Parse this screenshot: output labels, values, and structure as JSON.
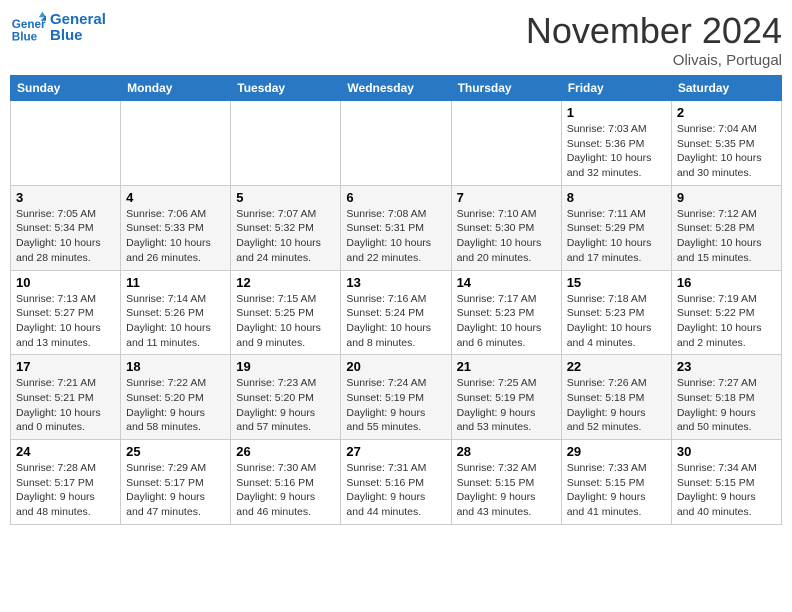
{
  "header": {
    "logo_line1": "General",
    "logo_line2": "Blue",
    "month": "November 2024",
    "location": "Olivais, Portugal"
  },
  "days_of_week": [
    "Sunday",
    "Monday",
    "Tuesday",
    "Wednesday",
    "Thursday",
    "Friday",
    "Saturday"
  ],
  "weeks": [
    [
      {
        "day": "",
        "info": ""
      },
      {
        "day": "",
        "info": ""
      },
      {
        "day": "",
        "info": ""
      },
      {
        "day": "",
        "info": ""
      },
      {
        "day": "",
        "info": ""
      },
      {
        "day": "1",
        "info": "Sunrise: 7:03 AM\nSunset: 5:36 PM\nDaylight: 10 hours and 32 minutes."
      },
      {
        "day": "2",
        "info": "Sunrise: 7:04 AM\nSunset: 5:35 PM\nDaylight: 10 hours and 30 minutes."
      }
    ],
    [
      {
        "day": "3",
        "info": "Sunrise: 7:05 AM\nSunset: 5:34 PM\nDaylight: 10 hours and 28 minutes."
      },
      {
        "day": "4",
        "info": "Sunrise: 7:06 AM\nSunset: 5:33 PM\nDaylight: 10 hours and 26 minutes."
      },
      {
        "day": "5",
        "info": "Sunrise: 7:07 AM\nSunset: 5:32 PM\nDaylight: 10 hours and 24 minutes."
      },
      {
        "day": "6",
        "info": "Sunrise: 7:08 AM\nSunset: 5:31 PM\nDaylight: 10 hours and 22 minutes."
      },
      {
        "day": "7",
        "info": "Sunrise: 7:10 AM\nSunset: 5:30 PM\nDaylight: 10 hours and 20 minutes."
      },
      {
        "day": "8",
        "info": "Sunrise: 7:11 AM\nSunset: 5:29 PM\nDaylight: 10 hours and 17 minutes."
      },
      {
        "day": "9",
        "info": "Sunrise: 7:12 AM\nSunset: 5:28 PM\nDaylight: 10 hours and 15 minutes."
      }
    ],
    [
      {
        "day": "10",
        "info": "Sunrise: 7:13 AM\nSunset: 5:27 PM\nDaylight: 10 hours and 13 minutes."
      },
      {
        "day": "11",
        "info": "Sunrise: 7:14 AM\nSunset: 5:26 PM\nDaylight: 10 hours and 11 minutes."
      },
      {
        "day": "12",
        "info": "Sunrise: 7:15 AM\nSunset: 5:25 PM\nDaylight: 10 hours and 9 minutes."
      },
      {
        "day": "13",
        "info": "Sunrise: 7:16 AM\nSunset: 5:24 PM\nDaylight: 10 hours and 8 minutes."
      },
      {
        "day": "14",
        "info": "Sunrise: 7:17 AM\nSunset: 5:23 PM\nDaylight: 10 hours and 6 minutes."
      },
      {
        "day": "15",
        "info": "Sunrise: 7:18 AM\nSunset: 5:23 PM\nDaylight: 10 hours and 4 minutes."
      },
      {
        "day": "16",
        "info": "Sunrise: 7:19 AM\nSunset: 5:22 PM\nDaylight: 10 hours and 2 minutes."
      }
    ],
    [
      {
        "day": "17",
        "info": "Sunrise: 7:21 AM\nSunset: 5:21 PM\nDaylight: 10 hours and 0 minutes."
      },
      {
        "day": "18",
        "info": "Sunrise: 7:22 AM\nSunset: 5:20 PM\nDaylight: 9 hours and 58 minutes."
      },
      {
        "day": "19",
        "info": "Sunrise: 7:23 AM\nSunset: 5:20 PM\nDaylight: 9 hours and 57 minutes."
      },
      {
        "day": "20",
        "info": "Sunrise: 7:24 AM\nSunset: 5:19 PM\nDaylight: 9 hours and 55 minutes."
      },
      {
        "day": "21",
        "info": "Sunrise: 7:25 AM\nSunset: 5:19 PM\nDaylight: 9 hours and 53 minutes."
      },
      {
        "day": "22",
        "info": "Sunrise: 7:26 AM\nSunset: 5:18 PM\nDaylight: 9 hours and 52 minutes."
      },
      {
        "day": "23",
        "info": "Sunrise: 7:27 AM\nSunset: 5:18 PM\nDaylight: 9 hours and 50 minutes."
      }
    ],
    [
      {
        "day": "24",
        "info": "Sunrise: 7:28 AM\nSunset: 5:17 PM\nDaylight: 9 hours and 48 minutes."
      },
      {
        "day": "25",
        "info": "Sunrise: 7:29 AM\nSunset: 5:17 PM\nDaylight: 9 hours and 47 minutes."
      },
      {
        "day": "26",
        "info": "Sunrise: 7:30 AM\nSunset: 5:16 PM\nDaylight: 9 hours and 46 minutes."
      },
      {
        "day": "27",
        "info": "Sunrise: 7:31 AM\nSunset: 5:16 PM\nDaylight: 9 hours and 44 minutes."
      },
      {
        "day": "28",
        "info": "Sunrise: 7:32 AM\nSunset: 5:15 PM\nDaylight: 9 hours and 43 minutes."
      },
      {
        "day": "29",
        "info": "Sunrise: 7:33 AM\nSunset: 5:15 PM\nDaylight: 9 hours and 41 minutes."
      },
      {
        "day": "30",
        "info": "Sunrise: 7:34 AM\nSunset: 5:15 PM\nDaylight: 9 hours and 40 minutes."
      }
    ]
  ]
}
